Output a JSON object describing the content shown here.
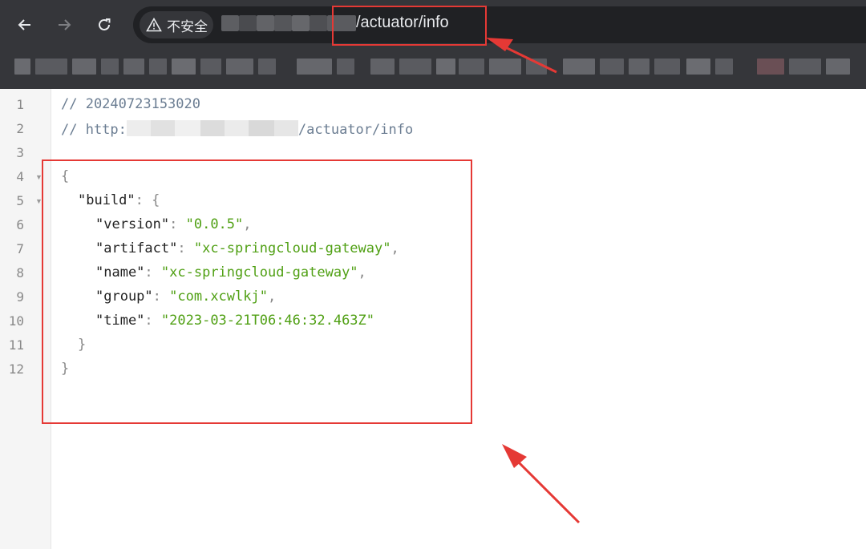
{
  "toolbar": {
    "back_icon": "arrow-left-icon",
    "forward_icon": "arrow-right-icon",
    "reload_icon": "reload-icon"
  },
  "address_bar": {
    "security_label": "不安全",
    "warning_icon": "warning-triangle-icon",
    "url_path": "/actuator/info"
  },
  "code": {
    "line_numbers": [
      "1",
      "2",
      "3",
      "4",
      "5",
      "6",
      "7",
      "8",
      "9",
      "10",
      "11",
      "12"
    ],
    "comment_timestamp": "// 20240723153020",
    "comment_url_prefix": "// http:",
    "comment_url_suffix": "/actuator/info",
    "open_brace": "{",
    "build_key": "\"build\"",
    "build_open": ": {",
    "fields": [
      {
        "key": "\"version\"",
        "value": "\"0.0.5\"",
        "comma": ","
      },
      {
        "key": "\"artifact\"",
        "value": "\"xc-springcloud-gateway\"",
        "comma": ","
      },
      {
        "key": "\"name\"",
        "value": "\"xc-springcloud-gateway\"",
        "comma": ","
      },
      {
        "key": "\"group\"",
        "value": "\"com.xcwlkj\"",
        "comma": ","
      },
      {
        "key": "\"time\"",
        "value": "\"2023-03-21T06:46:32.463Z\"",
        "comma": ""
      }
    ],
    "inner_close": "}",
    "outer_close": "}"
  },
  "colors": {
    "annotation_red": "#e53935",
    "string_green": "#50a014",
    "chrome_dark": "#35363a"
  }
}
